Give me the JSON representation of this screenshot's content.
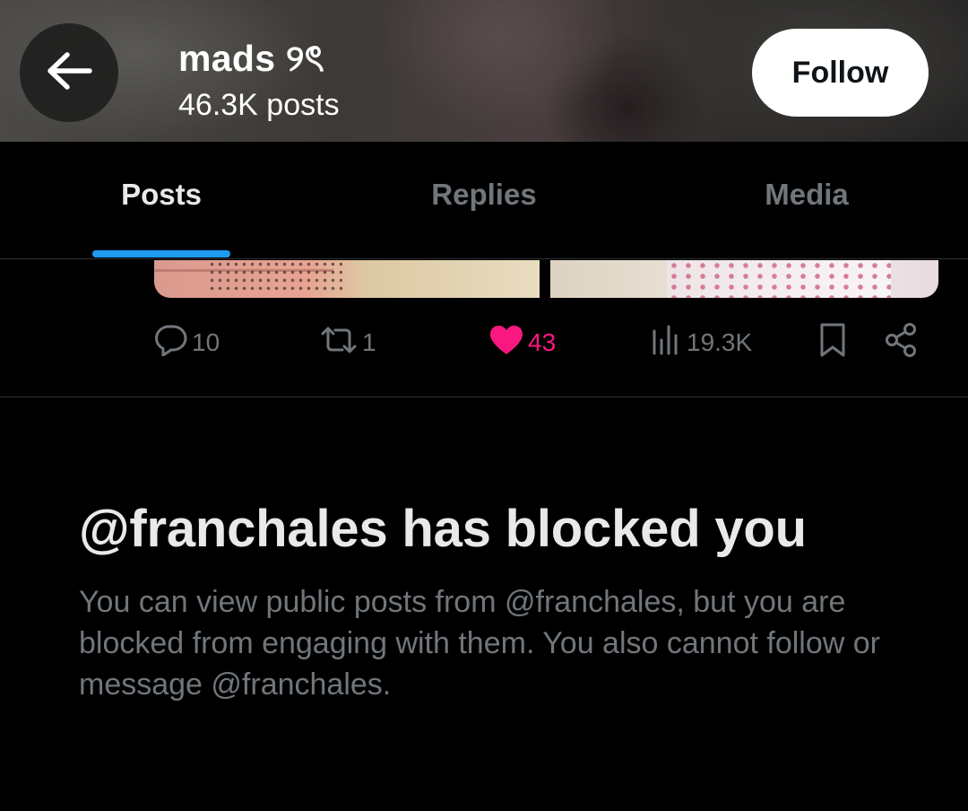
{
  "header": {
    "display_name": "mads ୨ৎ",
    "post_count": "46.3K posts",
    "follow_label": "Follow"
  },
  "tabs": [
    {
      "label": "Posts",
      "active": true
    },
    {
      "label": "Replies",
      "active": false
    },
    {
      "label": "Media",
      "active": false
    }
  ],
  "post": {
    "replies": "10",
    "reposts": "1",
    "likes": "43",
    "views": "19.3K",
    "liked": true
  },
  "blocked": {
    "title": "@franchales has blocked you",
    "description": "You can view public posts from @franchales, but you are blocked from engaging with them. You also cannot follow or message @franchales."
  },
  "colors": {
    "accent": "#1d9bf0",
    "like": "#f91880",
    "muted": "#71767b",
    "background": "#000000"
  },
  "icons": [
    "back-arrow-icon",
    "reply-icon",
    "repost-icon",
    "heart-icon",
    "views-icon",
    "bookmark-icon",
    "share-icon"
  ]
}
